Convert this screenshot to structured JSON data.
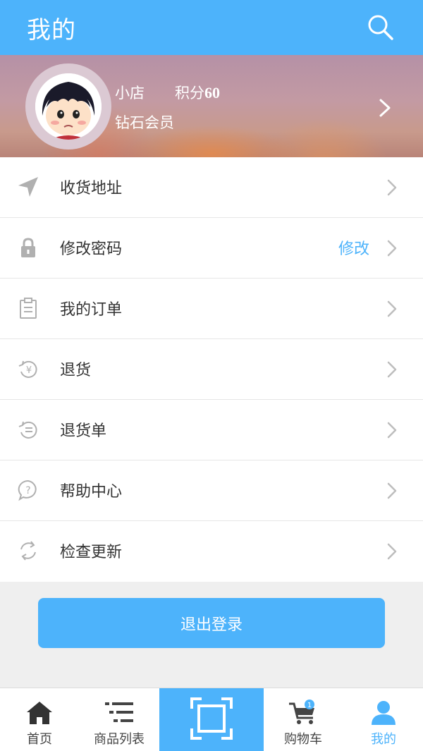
{
  "header": {
    "title": "我的",
    "search_icon": "search-icon"
  },
  "profile": {
    "name": "小店",
    "points_label": "积分",
    "points_value": "60",
    "level": "钻石会员",
    "avatar": "cartoon-girl-avatar"
  },
  "menu": {
    "items": [
      {
        "label": "收货地址",
        "icon": "location-arrow-icon"
      },
      {
        "label": "修改密码",
        "icon": "lock-icon",
        "action": "修改"
      },
      {
        "label": "我的订单",
        "icon": "clipboard-icon"
      },
      {
        "label": "退货",
        "icon": "refund-yen-icon"
      },
      {
        "label": "退货单",
        "icon": "return-list-icon"
      },
      {
        "label": "帮助中心",
        "icon": "help-bubble-icon"
      },
      {
        "label": "检查更新",
        "icon": "refresh-icon"
      }
    ]
  },
  "logout": {
    "label": "退出登录"
  },
  "tabbar": {
    "items": [
      {
        "label": "首页",
        "icon": "home-icon"
      },
      {
        "label": "商品列表",
        "icon": "list-icon"
      },
      {
        "label": "",
        "icon": "scan-icon"
      },
      {
        "label": "购物车",
        "icon": "cart-icon",
        "badge": "1"
      },
      {
        "label": "我的",
        "icon": "user-icon",
        "active": true
      }
    ]
  },
  "colors": {
    "accent": "#4db3fb",
    "text": "#333333",
    "icon_gray": "#aaaaaa"
  }
}
